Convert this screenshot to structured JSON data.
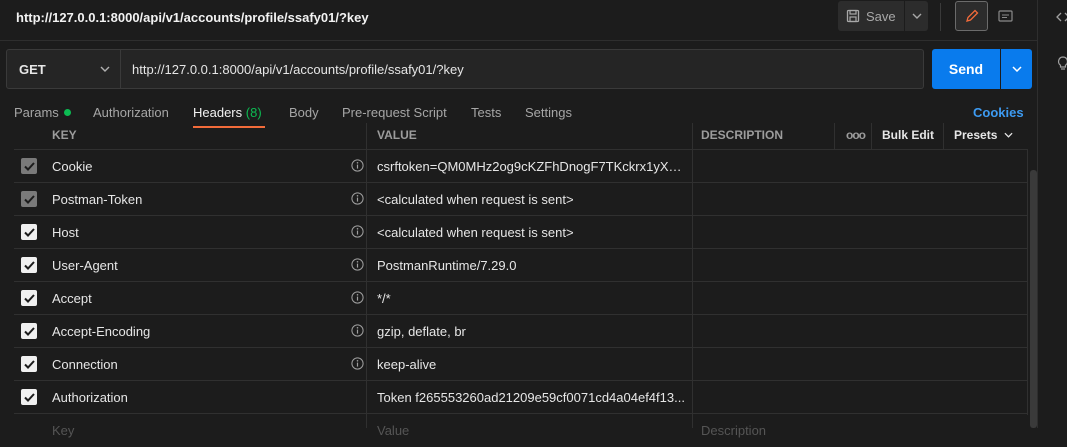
{
  "request_title": "http://127.0.0.1:8000/api/v1/accounts/profile/ssafy01/?key",
  "toolbar": {
    "save_label": "Save"
  },
  "method": "GET",
  "url": "http://127.0.0.1:8000/api/v1/accounts/profile/ssafy01/?key",
  "send_label": "Send",
  "tabs": [
    {
      "label": "Params"
    },
    {
      "label": "Authorization"
    },
    {
      "label": "Headers",
      "count": "(8)"
    },
    {
      "label": "Body"
    },
    {
      "label": "Pre-request Script"
    },
    {
      "label": "Tests"
    },
    {
      "label": "Settings"
    }
  ],
  "cookies_label": "Cookies",
  "table": {
    "columns": {
      "key": "KEY",
      "value": "VALUE",
      "description": "DESCRIPTION",
      "more": "ooo",
      "bulk_edit": "Bulk Edit",
      "presets": "Presets"
    },
    "rows": [
      {
        "key": "Cookie",
        "value": "csrftoken=QM0MHz2og9cKZFhDnogF7TKckrx1yXwE...",
        "state": "auto"
      },
      {
        "key": "Postman-Token",
        "value": "<calculated when request is sent>",
        "state": "auto"
      },
      {
        "key": "Host",
        "value": "<calculated when request is sent>",
        "state": "on"
      },
      {
        "key": "User-Agent",
        "value": "PostmanRuntime/7.29.0",
        "state": "on"
      },
      {
        "key": "Accept",
        "value": "*/*",
        "state": "on"
      },
      {
        "key": "Accept-Encoding",
        "value": "gzip, deflate, br",
        "state": "on"
      },
      {
        "key": "Connection",
        "value": "keep-alive",
        "state": "on"
      },
      {
        "key": "Authorization",
        "value": "Token f265553260ad21209e59cf0071cd4a04ef4f13...",
        "state": "on"
      }
    ],
    "placeholders": {
      "key": "Key",
      "value": "Value",
      "description": "Description"
    }
  },
  "colors": {
    "accent_send": "#097bed",
    "tab_underline": "#f26b3a",
    "count_green": "#0cbb52",
    "cookies_link": "#3d9bf2"
  }
}
